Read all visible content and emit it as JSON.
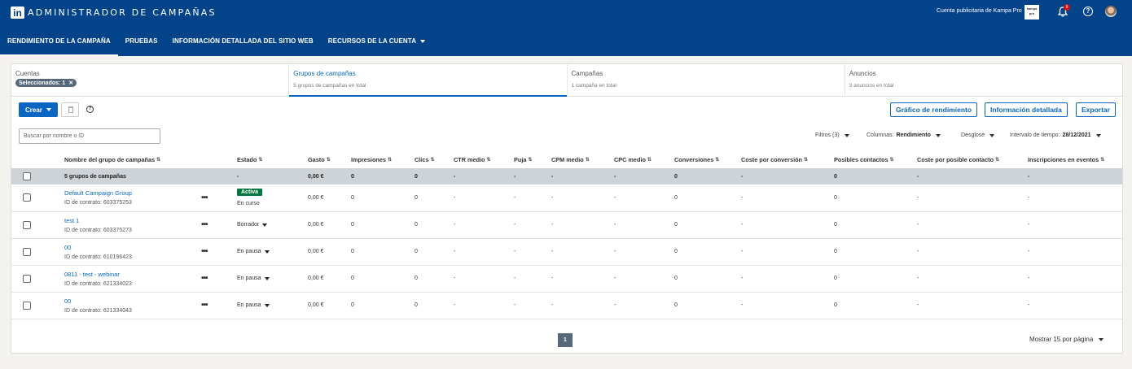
{
  "app": {
    "logo_text": "in",
    "title": "ADMINISTRADOR DE CAMPAÑAS",
    "account_label": "Cuenta publicitaria de Kampa Pro",
    "account_logo_text": "kampa pro",
    "notification_count": "9",
    "help_glyph": "?"
  },
  "nav": [
    {
      "label": "RENDIMIENTO DE LA CAMPAÑA",
      "active": true
    },
    {
      "label": "PRUEBAS"
    },
    {
      "label": "INFORMACIÓN DETALLADA DEL SITIO WEB"
    },
    {
      "label": "RECURSOS DE LA CUENTA",
      "dropdown": true
    }
  ],
  "tabs": {
    "accounts": {
      "title": "Cuentas",
      "chip": "Seleccionados: 1",
      "chip_close": "✕"
    },
    "groups": {
      "title": "Grupos de campañas",
      "sub": "5 grupos de campañas en total"
    },
    "campaigns": {
      "title": "Campañas",
      "sub": "1 campaña en total"
    },
    "ads": {
      "title": "Anuncios",
      "sub": "3 anuncios en total"
    }
  },
  "toolbar": {
    "create_label": "Crear",
    "help_glyph": "?",
    "chart_button": "Gráfico de rendimiento",
    "insights_button": "Información detallada",
    "export_button": "Exportar"
  },
  "filters": {
    "search_placeholder": "Buscar por nombre o ID",
    "filters_label": "Filtros (3)",
    "columns_label": "Columnas:",
    "columns_value": "Rendimiento",
    "breakdown_label": "Desglose",
    "interval_label": "Intervalo de tiempo:",
    "interval_value": "28/12/2021"
  },
  "table": {
    "headers": {
      "name": "Nombre del grupo de campañas",
      "status": "Estado",
      "spend": "Gasto",
      "impressions": "Impresiones",
      "clicks": "Clics",
      "ctr": "CTR medio",
      "bid": "Puja",
      "cpm": "CPM medio",
      "cpc": "CPC medio",
      "conversions": "Conversiones",
      "cost_conv": "Coste por conversión",
      "leads": "Posibles contactos",
      "cost_lead": "Coste por posible contacto",
      "registrations": "Inscripciones en eventos"
    },
    "sort_glyph": "⇅",
    "summary": {
      "name": "5 grupos de campañas",
      "status": "-",
      "spend": "0,00 €",
      "impressions": "0",
      "clicks": "0",
      "ctr": "-",
      "bid": "-",
      "cpm": "-",
      "cpc": "-",
      "conversions": "0",
      "cost_conv": "-",
      "leads": "0",
      "cost_lead": "-",
      "registrations": "-"
    },
    "rows": [
      {
        "name": "Default Campaign Group",
        "id": "ID de contrato: 603375253",
        "more": "•••",
        "badge": "Activa",
        "status": "En curso",
        "spend": "0,00 €",
        "impressions": "0",
        "clicks": "0",
        "ctr": "-",
        "bid": "-",
        "cpm": "-",
        "cpc": "-",
        "conversions": "0",
        "cost_conv": "-",
        "leads": "0",
        "cost_lead": "-",
        "registrations": "-"
      },
      {
        "name": "test 1",
        "id": "ID de contrato: 603375273",
        "more": "•••",
        "status": "Borrador",
        "spend": "0,00 €",
        "impressions": "0",
        "clicks": "0",
        "ctr": "-",
        "bid": "-",
        "cpm": "-",
        "cpc": "-",
        "conversions": "0",
        "cost_conv": "-",
        "leads": "0",
        "cost_lead": "-",
        "registrations": "-"
      },
      {
        "name": "00",
        "id": "ID de contrato: 610196423",
        "more": "•••",
        "status": "En pausa",
        "spend": "0,00 €",
        "impressions": "0",
        "clicks": "0",
        "ctr": "-",
        "bid": "-",
        "cpm": "-",
        "cpc": "-",
        "conversions": "0",
        "cost_conv": "-",
        "leads": "0",
        "cost_lead": "-",
        "registrations": "-"
      },
      {
        "name": "0811 - test - webinar",
        "id": "ID de contrato: 621334023",
        "more": "•••",
        "status": "En pausa",
        "spend": "0,00 €",
        "impressions": "0",
        "clicks": "0",
        "ctr": "-",
        "bid": "-",
        "cpm": "-",
        "cpc": "-",
        "conversions": "0",
        "cost_conv": "-",
        "leads": "0",
        "cost_lead": "-",
        "registrations": "-"
      },
      {
        "name": "00",
        "id": "ID de contrato: 621334043",
        "more": "•••",
        "status": "En pausa",
        "spend": "0,00 €",
        "impressions": "0",
        "clicks": "0",
        "ctr": "-",
        "bid": "-",
        "cpm": "-",
        "cpc": "-",
        "conversions": "0",
        "cost_conv": "-",
        "leads": "0",
        "cost_lead": "-",
        "registrations": "-"
      }
    ]
  },
  "pagination": {
    "current_page": "1",
    "per_page_label": "Mostrar 15 por página"
  },
  "colors": {
    "header_bg": "#034389",
    "primary": "#0a66c2",
    "active_badge": "#057642",
    "summary_row": "#ced3d8"
  },
  "icons": [
    "linkedin-logo-icon",
    "bell-icon",
    "help-icon",
    "avatar",
    "trash-icon",
    "chevron-down-icon",
    "sort-icon",
    "more-icon"
  ]
}
